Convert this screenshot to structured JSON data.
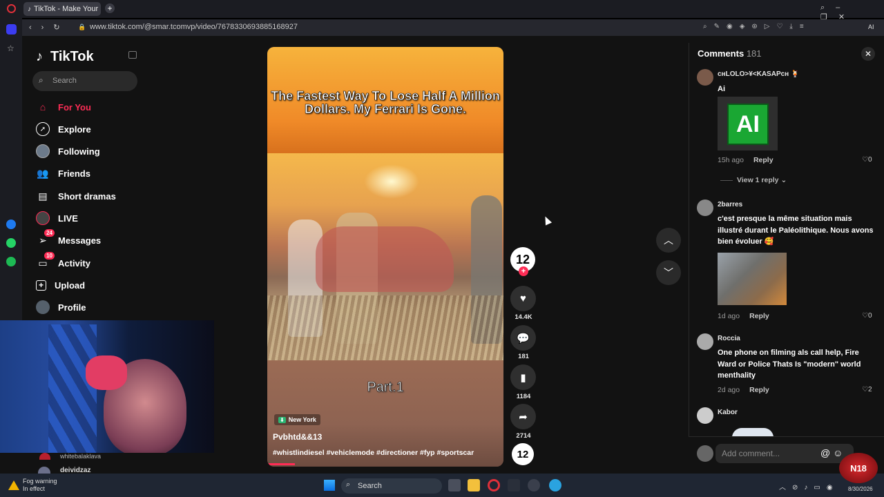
{
  "browser": {
    "tab_title": "TikTok - Make Your Da",
    "url": "www.tiktok.com/@smar.tcomvp/video/7678330693885168927",
    "right_label": "AI"
  },
  "sidebar": {
    "logo": "TikTok",
    "search_placeholder": "Search",
    "items": [
      {
        "label": "For You",
        "icon": "home-icon",
        "active": true
      },
      {
        "label": "Explore",
        "icon": "compass-icon"
      },
      {
        "label": "Following",
        "icon": "following-avatar-icon"
      },
      {
        "label": "Friends",
        "icon": "friends-icon"
      },
      {
        "label": "Short dramas",
        "icon": "film-icon"
      },
      {
        "label": "LIVE",
        "icon": "live-icon"
      },
      {
        "label": "Messages",
        "icon": "message-icon",
        "badge": "24"
      },
      {
        "label": "Activity",
        "icon": "inbox-icon",
        "badge": "10"
      },
      {
        "label": "Upload",
        "icon": "upload-icon"
      },
      {
        "label": "Profile",
        "icon": "profile-avatar-icon"
      }
    ]
  },
  "video": {
    "title_text": "The Fastest Way To Lose Half A Million Dollars. My Ferrari Is Gone.",
    "part_text": "Part.1",
    "location": "New York",
    "author": "Pvbhtd&&13",
    "hashtags": "#whistlindiesel #vehiclemode #directioner #fyp #sportscar",
    "avatar_text": "12"
  },
  "actions": {
    "likes": "14.4K",
    "comments": "181",
    "saves": "1184",
    "shares": "2714"
  },
  "comments": {
    "header": "Comments",
    "count": "181",
    "view_replies": "View 1 reply",
    "input_placeholder": "Add comment...",
    "list": [
      {
        "user": "ᴄʜLOLO>¥<KASAPᴄʜ 🍹",
        "text": "Ai",
        "time": "15h ago",
        "reply": "Reply",
        "likes": "0",
        "image_text": "AI"
      },
      {
        "user": "2barres",
        "text": "c'est presque la même situation mais illustré durant le Paléolithique. Nous avons bien évoluer 🥰",
        "time": "1d ago",
        "reply": "Reply",
        "likes": "0"
      },
      {
        "user": "Roccia",
        "text": "One phone on filming als call help, Fire Ward or Police Thats Is \"modern\" world menthality",
        "time": "2d ago",
        "reply": "Reply",
        "likes": "2"
      },
      {
        "user": "Kabor"
      }
    ]
  },
  "stream": {
    "chat1": "whitebalaklava",
    "chat2": "deividzaz"
  },
  "taskbar": {
    "weather_title": "Fog warning",
    "weather_sub": "In effect",
    "search": "Search",
    "date": "8/30/2026",
    "overlay_logo": "N18"
  }
}
